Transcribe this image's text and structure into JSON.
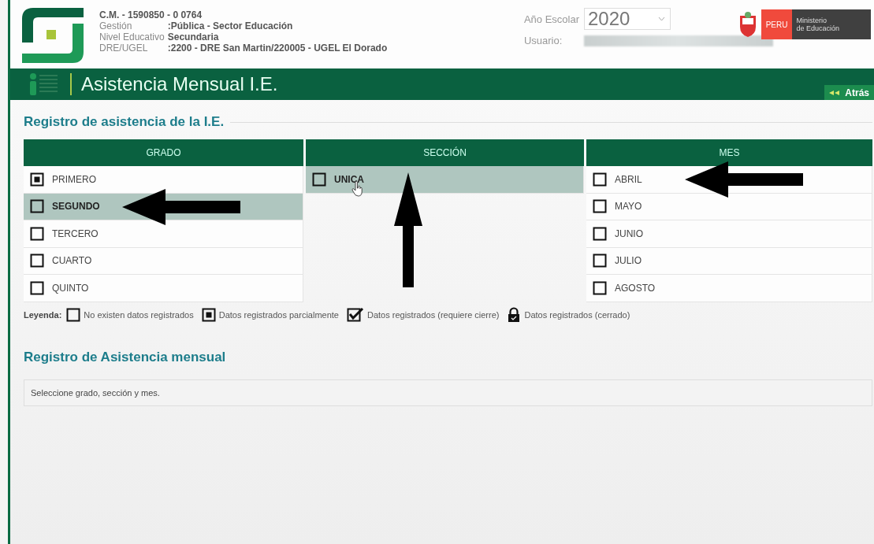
{
  "header": {
    "code": "C.M. - 1590850 - 0  0764",
    "info": [
      {
        "label": "Gestión",
        "value": ":Pública - Sector Educación"
      },
      {
        "label": "Nivel Educativo",
        "value": "Secundaria"
      },
      {
        "label": "DRE/UGEL",
        "value": ":2200 - DRE San Martin/220005 - UGEL El Dorado"
      }
    ],
    "year_label": "Año Escolar",
    "year": "2020",
    "user_label": "Usuario:",
    "brand_country": "PERU",
    "brand_ministry": [
      "Ministerio",
      "de Educación"
    ]
  },
  "title_bar": {
    "title": "Asistencia Mensual I.E.",
    "back_button": "Atrás"
  },
  "section_title": "Registro de asistencia de la I.E.",
  "columns": [
    {
      "heading": "GRADO",
      "items": [
        {
          "label": "PRIMERO",
          "kind": "partial",
          "selected": false
        },
        {
          "label": "SEGUNDO",
          "kind": "empty",
          "selected": true,
          "arrow": {
            "kind": "left"
          }
        },
        {
          "label": "TERCERO",
          "kind": "empty",
          "selected": false
        },
        {
          "label": "CUARTO",
          "kind": "empty",
          "selected": false
        },
        {
          "label": "QUINTO",
          "kind": "empty",
          "selected": false
        }
      ]
    },
    {
      "heading": "SECCIÓN",
      "items": [
        {
          "label": "UNICA",
          "kind": "empty",
          "selected": true,
          "arrow": {
            "kind": "up"
          },
          "hover": true
        }
      ]
    },
    {
      "heading": "MES",
      "items": [
        {
          "label": "ABRIL",
          "kind": "empty",
          "selected": false,
          "arrow": {
            "kind": "left"
          }
        },
        {
          "label": "MAYO",
          "kind": "empty",
          "selected": false
        },
        {
          "label": "JUNIO",
          "kind": "empty",
          "selected": false
        },
        {
          "label": "JULIO",
          "kind": "empty",
          "selected": false
        },
        {
          "label": "AGOSTO",
          "kind": "empty",
          "selected": false
        }
      ]
    }
  ],
  "legend": {
    "label": "Leyenda:",
    "items": [
      {
        "kind": "empty",
        "text": "No existen datos registrados"
      },
      {
        "kind": "partial",
        "text": "Datos registrados parcialmente"
      },
      {
        "kind": "checked",
        "text": "Datos registrados (requiere cierre)"
      },
      {
        "kind": "locked",
        "text": "Datos registrados (cerrado)"
      }
    ]
  },
  "monthly_title": "Registro de Asistencia mensual",
  "message": "Seleccione grado, sección y mes."
}
